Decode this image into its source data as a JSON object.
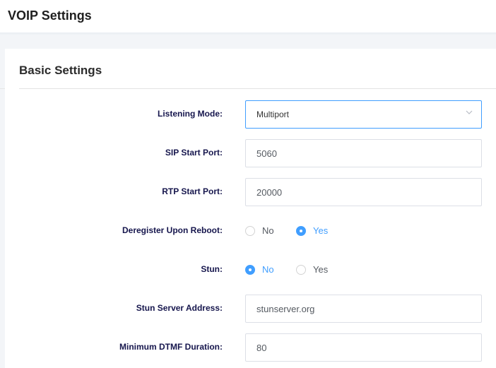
{
  "header": {
    "title": "VOIP Settings"
  },
  "section": {
    "title": "Basic Settings"
  },
  "fields": {
    "listening_mode": {
      "label": "Listening Mode:",
      "value": "Multiport"
    },
    "sip_start_port": {
      "label": "SIP Start Port:",
      "value": "5060"
    },
    "rtp_start_port": {
      "label": "RTP Start Port:",
      "value": "20000"
    },
    "deregister_upon_reboot": {
      "label": "Deregister Upon Reboot:",
      "options": [
        "No",
        "Yes"
      ],
      "selected": "Yes"
    },
    "stun": {
      "label": "Stun:",
      "options": [
        "No",
        "Yes"
      ],
      "selected": "No"
    },
    "stun_server_address": {
      "label": "Stun Server Address:",
      "value": "stunserver.org"
    },
    "minimum_dtmf_duration": {
      "label": "Minimum DTMF Duration:",
      "value": "80"
    }
  },
  "colors": {
    "accent": "#409eff",
    "label": "#16164d",
    "input_border": "#dcdfe6"
  },
  "icons": {
    "dropdown": "chevron-down-icon"
  }
}
